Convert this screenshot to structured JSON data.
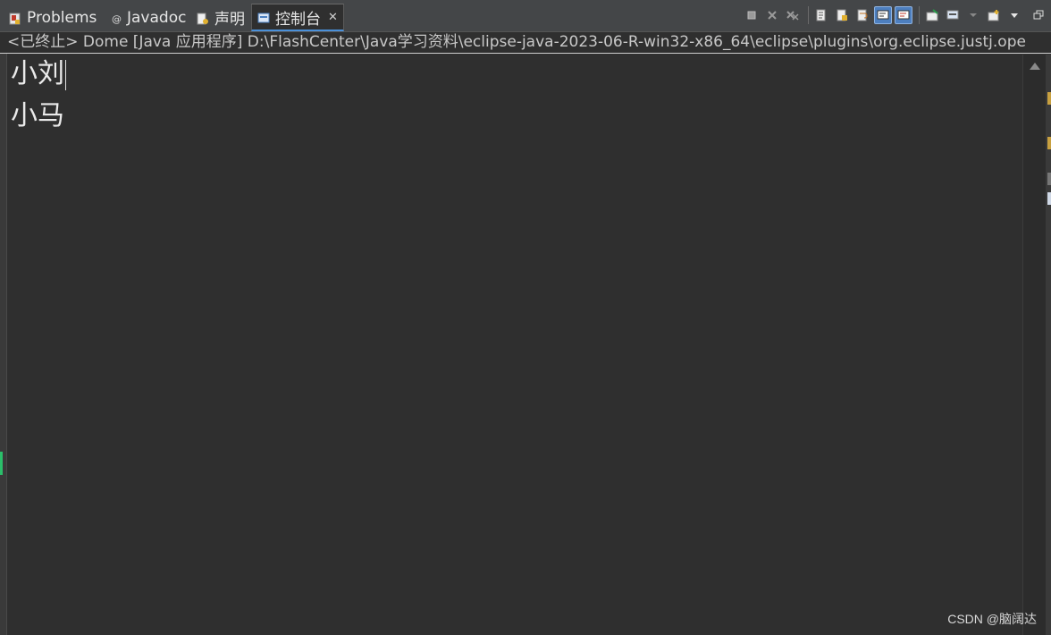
{
  "tabs": [
    {
      "label": "Problems",
      "icon": "problems-icon"
    },
    {
      "label": "Javadoc",
      "icon": "javadoc-icon"
    },
    {
      "label": "声明",
      "icon": "declaration-icon"
    },
    {
      "label": "控制台",
      "icon": "console-icon",
      "active": true
    }
  ],
  "status": {
    "text": "<已终止> Dome [Java 应用程序] D:\\FlashCenter\\Java学习资料\\eclipse-java-2023-06-R-win32-x86_64\\eclipse\\plugins\\org.eclipse.justj.ope"
  },
  "console": {
    "lines": [
      "小刘",
      "小马"
    ]
  },
  "watermark": "CSDN @脑阔达",
  "colors": {
    "accent": "#4a90d9",
    "background": "#2f2f2f",
    "tabbar": "#444648"
  }
}
